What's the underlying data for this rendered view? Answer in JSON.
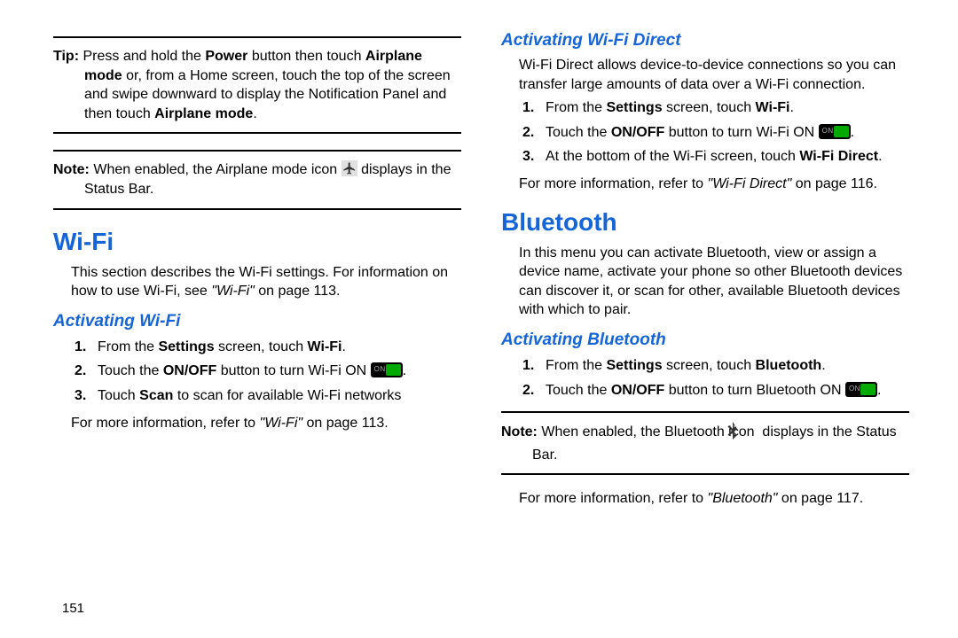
{
  "left": {
    "tip": {
      "label": "Tip:",
      "t1": "Press and hold the ",
      "b1": "Power",
      "t2": " button then touch ",
      "b2": "Airplane mode",
      "t3": " or, from a Home screen, touch the top of the screen and swipe downward to display the Notification Panel and then touch ",
      "b3": "Airplane mode",
      "t4": "."
    },
    "note": {
      "label": "Note:",
      "t1": "When enabled, the Airplane mode icon ",
      "t2": " displays in the Status Bar."
    },
    "wifi_heading": "Wi-Fi",
    "wifi_intro_1": "This section describes the Wi-Fi settings. For information on how to use Wi-Fi, see ",
    "wifi_intro_ref": "\"Wi-Fi\"",
    "wifi_intro_2": " on page 113.",
    "activating_wifi": "Activating Wi-Fi",
    "steps": {
      "s1a": "From the ",
      "s1b": "Settings",
      "s1c": " screen, touch ",
      "s1d": "Wi-Fi",
      "s1e": ".",
      "s2a": "Touch the ",
      "s2b": "ON/OFF",
      "s2c": " button to turn Wi-Fi ON ",
      "s2d": ".",
      "s3a": "Touch ",
      "s3b": "Scan",
      "s3c": " to scan for available Wi-Fi networks"
    },
    "more_1": "For more information, refer to ",
    "more_ref": "\"Wi-Fi\"",
    "more_2": " on page 113.",
    "page_num": "151"
  },
  "right": {
    "wifi_direct": "Activating Wi-Fi Direct",
    "wifi_direct_intro": "Wi-Fi Direct allows device-to-device connections so you can transfer large amounts of data over a Wi-Fi connection.",
    "steps_wd": {
      "s1a": "From the ",
      "s1b": "Settings",
      "s1c": " screen, touch ",
      "s1d": "Wi-Fi",
      "s1e": ".",
      "s2a": "Touch the ",
      "s2b": "ON/OFF",
      "s2c": " button to turn Wi-Fi ON ",
      "s2d": ".",
      "s3a": "At the bottom of the Wi-Fi screen, touch ",
      "s3b": "Wi-Fi Direct",
      "s3c": "."
    },
    "wd_more_1": "For more information, refer to ",
    "wd_more_ref": "\"Wi-Fi Direct\"",
    "wd_more_2": " on page 116.",
    "bt_heading": "Bluetooth",
    "bt_intro": "In this menu you can activate Bluetooth, view or assign a device name, activate your phone so other Bluetooth devices can discover it, or scan for other, available Bluetooth devices with which to pair.",
    "activating_bt": "Activating Bluetooth",
    "steps_bt": {
      "s1a": "From the ",
      "s1b": "Settings",
      "s1c": " screen, touch ",
      "s1d": "Bluetooth",
      "s1e": ".",
      "s2a": "Touch the ",
      "s2b": "ON/OFF",
      "s2c": " button to turn Bluetooth ON ",
      "s2d": "."
    },
    "bt_note": {
      "label": "Note:",
      "t1": "When enabled, the Bluetooth icon ",
      "t2": " displays in the Status Bar."
    },
    "bt_more_1": "For more information, refer to ",
    "bt_more_ref": "\"Bluetooth\"",
    "bt_more_2": " on page 117."
  }
}
